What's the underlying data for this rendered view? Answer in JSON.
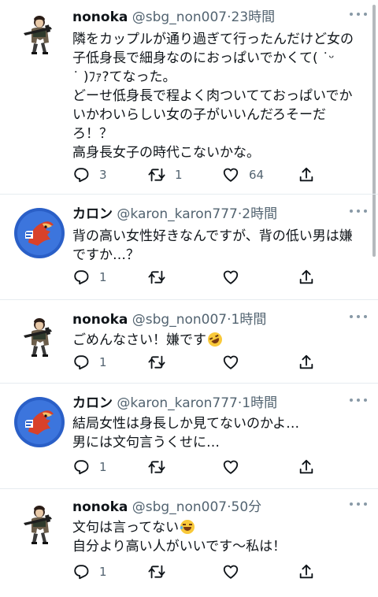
{
  "tweets": [
    {
      "author": "nonoka",
      "handle": "@sbg_non007",
      "time": "23時間",
      "lines": [
        "隣をカップルが通り過ぎて行ったんだけど女の",
        "子低身長で細身なのにおっぱいでかくて( ˙ᵕ",
        "˙ )ﾌｧ?てなった。",
        "どーせ低身長で程よく肉ついてておっぱいでか",
        "いかわいらしい女の子がいいんだろそーだ",
        "ろ！？",
        "高身長女子の時代こないかな。"
      ],
      "counts": {
        "reply": "3",
        "retweet": "1",
        "like": "64"
      }
    },
    {
      "author": "カロン",
      "handle": "@karon_karon777",
      "time": "2時間",
      "lines": [
        "背の高い女性好きなんですが、背の低い男は嫌",
        "ですか…？"
      ],
      "counts": {
        "reply": "1",
        "retweet": "",
        "like": ""
      }
    },
    {
      "author": "nonoka",
      "handle": "@sbg_non007",
      "time": "1時間",
      "lines": [
        "ごめんなさい！嫌です"
      ],
      "counts": {
        "reply": "1",
        "retweet": "",
        "like": ""
      }
    },
    {
      "author": "カロン",
      "handle": "@karon_karon777",
      "time": "1時間",
      "lines": [
        "結局女性は身長しか見てないのかよ…",
        "男には文句言うくせに…"
      ],
      "counts": {
        "reply": "1",
        "retweet": "",
        "like": ""
      }
    },
    {
      "author": "nonoka",
      "handle": "@sbg_non007",
      "time": "50分",
      "lines": [
        "文句は言ってない",
        "自分より高い人がいいです〜私は！"
      ],
      "counts": {
        "reply": "1",
        "retweet": "",
        "like": ""
      }
    }
  ],
  "separator": "·",
  "colors": {
    "text": "#0f1419",
    "secondary": "#536471",
    "divider": "#e6ecf0",
    "karon_avatar_bg": "#2a5fc7"
  },
  "icons": [
    "reply-icon",
    "retweet-icon",
    "like-icon",
    "share-icon",
    "more-icon",
    "rofl-emoji-icon",
    "laughing-emoji-icon"
  ]
}
